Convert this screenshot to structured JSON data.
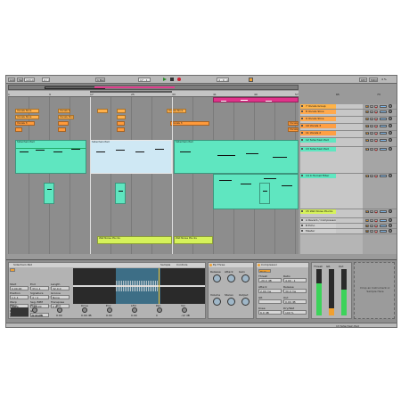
{
  "transport": {
    "link": "Link",
    "tap": "Tap",
    "tempo": "120.00",
    "sig": "4 / 4",
    "quantize": "1 Bar",
    "position": "17 . 1 . 1",
    "loop_len": "4 . 0 . 0",
    "key": "KEY",
    "midi": "MIDI",
    "cpu": "4 %"
  },
  "ruler": [
    "1",
    "9",
    "17",
    "25",
    "33",
    "41",
    "49",
    "57",
    "65",
    "73"
  ],
  "tracks": [
    {
      "name": "7 Vocals Group",
      "color": "#ffb347",
      "num": "7",
      "height": 6
    },
    {
      "name": "8 Vocals Slice",
      "color": "#ffa94d",
      "num": "8",
      "height": 8
    },
    {
      "name": "9 Vocals Slice",
      "color": "#ffa94d",
      "num": "9",
      "height": 8
    },
    {
      "name": "10 Vocals 3",
      "color": "#ff9f43",
      "num": "10",
      "height": 8
    },
    {
      "name": "11 Vocals 2",
      "color": "#ff9f43",
      "num": "11",
      "height": 8
    },
    {
      "name": "12 Sidechain Pad",
      "color": "#5fe6c0",
      "num": "12",
      "height": 10
    },
    {
      "name": "13 Sidechain Pad",
      "color": "#5fe6c0",
      "num": "13",
      "height": 30
    },
    {
      "name": "14 4 Hornet Filter",
      "color": "#5fe6c0",
      "num": "14",
      "height": 40
    },
    {
      "name": "15 Wet Noise Plucks",
      "color": "#d6f25a",
      "num": "15",
      "height": 10
    },
    {
      "name": "A Reverb / Compressor",
      "color": "#cfcfcf",
      "num": "A",
      "height": 6
    },
    {
      "name": "B Echo",
      "color": "#cfcfcf",
      "num": "B",
      "height": 6
    },
    {
      "name": "Master",
      "color": "#cfcfcf",
      "num": "M",
      "height": 6
    }
  ],
  "clips": {
    "pink_group": "",
    "vocals": [
      "Vocals Slice",
      "Vocals Slice",
      "Vocals 3",
      "Vocals 2"
    ],
    "sidechain": [
      "Sidechain Pad",
      "Sidechain Pad",
      "Sidechain Pad"
    ],
    "plucks": [
      "Wet Noise Plucks",
      "Wet Noise Plucks"
    ]
  },
  "mixer_sends": [
    "Sends",
    "Sends",
    "Sends",
    "Sends"
  ],
  "detail": {
    "clip_title": "Sidechain Pad",
    "clip_tabs": [
      "Sample",
      "Controls"
    ],
    "clip_fields": [
      "Start",
      "End",
      "Length",
      "Position",
      "Signature",
      "Groove",
      "Warp",
      "Seg. BPM",
      "Transpose",
      "Detune",
      "Gain"
    ],
    "clip_values": [
      "0.00.00",
      "33.1.1",
      "32.0.0",
      "1.1.1",
      "4 / 4",
      "None",
      "Warp",
      "120.00",
      "0 st",
      "0 ct",
      "0.00 dB"
    ],
    "filter_title": "Filter",
    "env_title": "Amp",
    "env_labels": [
      "Attack",
      "Decay",
      "Sustain",
      "Release"
    ],
    "env_values": [
      "0.00 ms",
      "600 ms",
      "0.0 dB",
      "50.0 ms"
    ],
    "knob_labels": [
      "Freq",
      "Res",
      "Drive",
      "Env",
      "LFO",
      "Pan",
      "Vol"
    ],
    "knob_values": [
      "22.0 kHz",
      "0.00",
      "0.00 dB",
      "0.00",
      "0.00",
      "C",
      "-12 dB"
    ],
    "device1": "Ep Three",
    "device1_labels": [
      "Release",
      "Attack",
      "Gain",
      "Volume",
      "Stereo",
      "Output"
    ],
    "device2": "Compressor",
    "device2_mode": "Peak",
    "device2_labels": [
      "Thresh",
      "Ratio",
      "Attack",
      "Release",
      "GR",
      "Out",
      "Knee",
      "Dry/Wet"
    ],
    "device2_values": [
      "-20.0 dB",
      "4.00 : 1",
      "2.00 ms",
      "30.0 ms",
      "",
      "0.00 dB",
      "6.0 dB",
      "100 %"
    ],
    "meter_labels": [
      "Thresh",
      "GR",
      "Out"
    ],
    "drop_hint": "Drop an Instrument or Sample Here"
  },
  "status": {
    "track": "13 Sidechain Pad"
  }
}
